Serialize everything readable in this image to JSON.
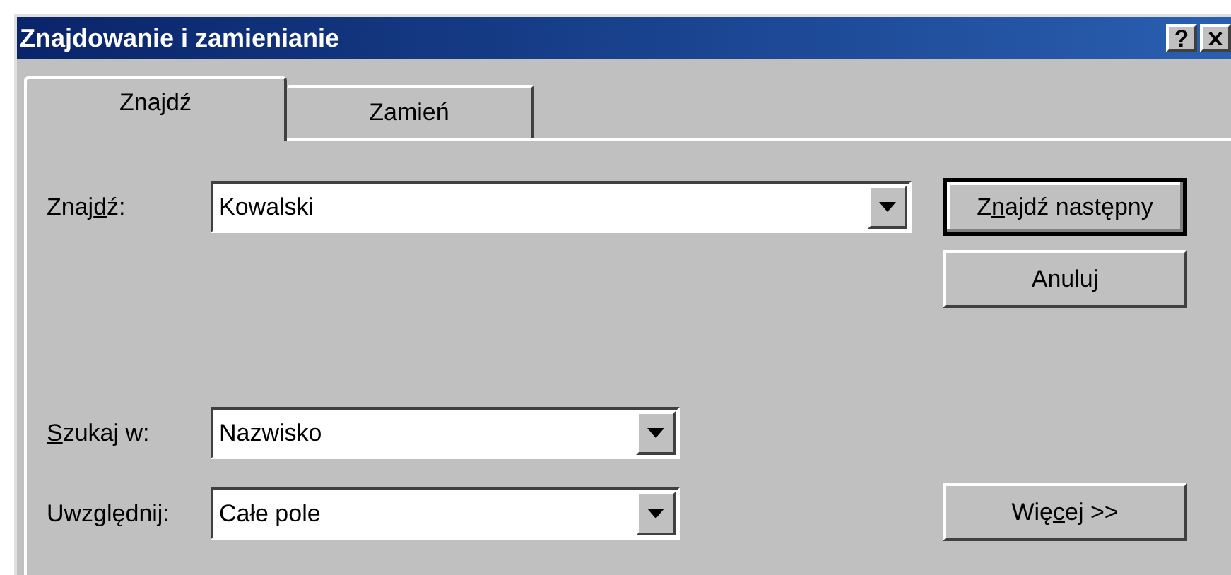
{
  "window": {
    "title": "Znajdowanie i zamienianie",
    "title_buttons": [
      {
        "kind": "help",
        "label": "?"
      },
      {
        "kind": "close"
      }
    ]
  },
  "tabs": [
    {
      "label": "Znajdź",
      "selected": true
    },
    {
      "label": "Zamień",
      "selected": false
    }
  ],
  "fields": [
    {
      "label_start": "Znaj",
      "access_key": "d",
      "label_end": "ź:",
      "value": "Kowalski",
      "kind": "wide"
    },
    {
      "access_key": "S",
      "label_end": "zukaj w:",
      "value": "Nazwisko",
      "kind": "narrow"
    },
    {
      "label_start": "Uwzględnij:",
      "value": "Całe pole",
      "kind": "narrow"
    }
  ],
  "buttons": [
    {
      "label_start": "Z",
      "access_key": "n",
      "label_end": "ajdź następny",
      "default": true
    },
    {
      "label_start": "Anuluj",
      "default": false
    },
    {
      "label_start": "Wię",
      "access_key": "c",
      "label_end": "ej >>",
      "default": false
    }
  ]
}
